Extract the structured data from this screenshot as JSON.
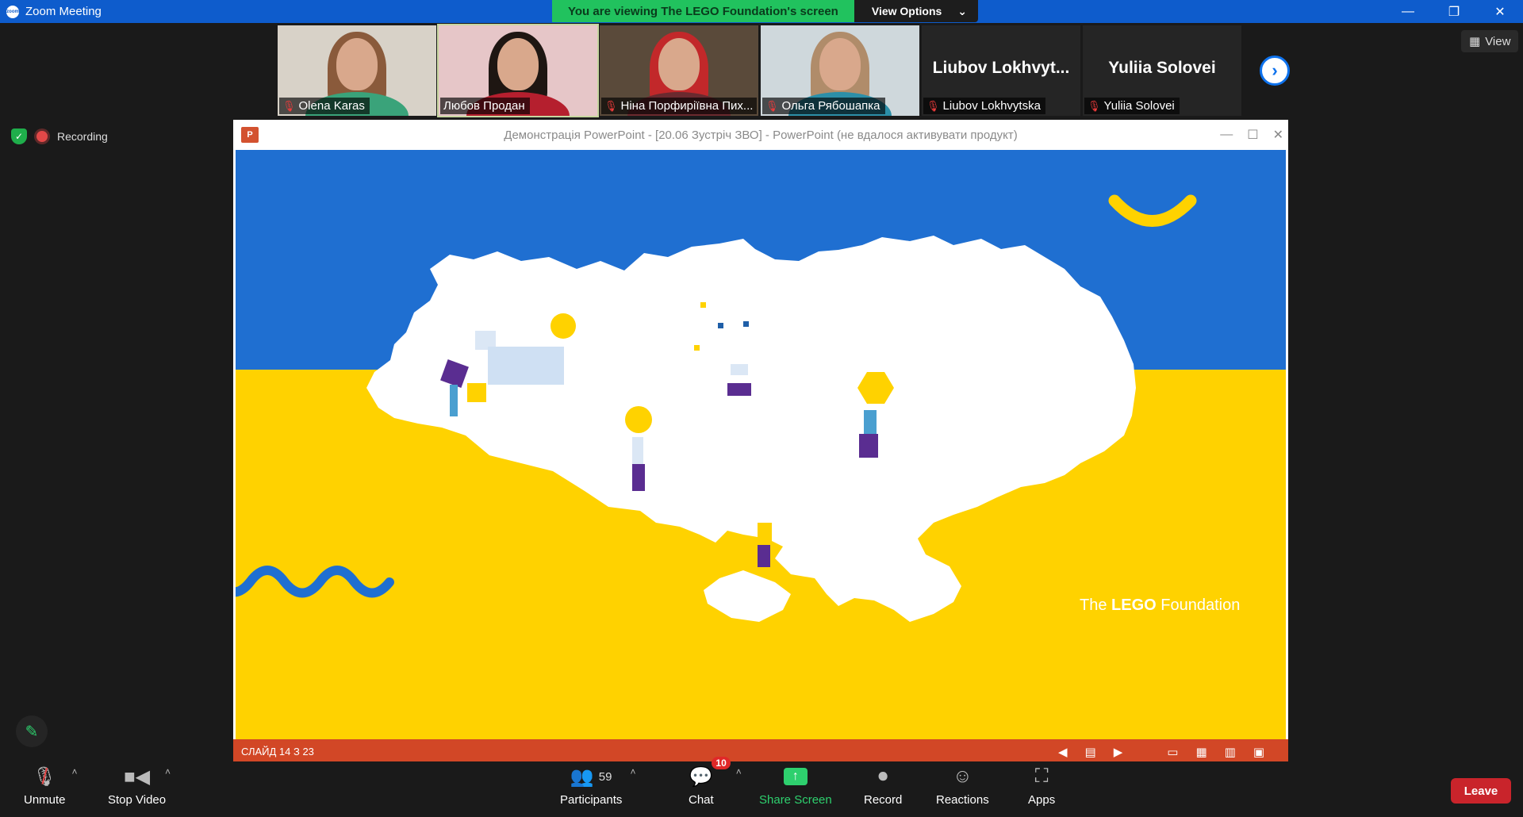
{
  "window": {
    "title": "Zoom Meeting",
    "minimize": "—",
    "restore": "❐",
    "close": "✕"
  },
  "share_banner": {
    "viewing": "You are viewing The LEGO Foundation's screen",
    "view_options": "View Options",
    "caret": "⌄"
  },
  "view_button": {
    "label": "View",
    "icon": "grid-icon"
  },
  "participants_strip": [
    {
      "name": "Olena Karas",
      "type": "video",
      "muted": true,
      "hair": "#8a5a3b",
      "shirt": "#3aa37a",
      "bg": "#d8d2c8"
    },
    {
      "name": "Любов Продан",
      "type": "video",
      "muted": false,
      "hair": "#1e1612",
      "shirt": "#b51f2e",
      "bg": "#e6c6c8"
    },
    {
      "name": "Ніна Порфиріївна Пих...",
      "type": "video",
      "muted": true,
      "hair": "#c2282a",
      "shirt": "#6b2a2f",
      "bg": "#5a4a3a"
    },
    {
      "name": "Ольга Рябошапка",
      "type": "video",
      "muted": true,
      "hair": "#b08c6a",
      "shirt": "#2c8fa8",
      "bg": "#cfd8dc"
    },
    {
      "name": "Liubov Lokhvytska",
      "display_name": "Liubov  Lokhvyt...",
      "type": "name",
      "muted": true
    },
    {
      "name": "Yuliia Solovei",
      "display_name": "Yuliia Solovei",
      "type": "name",
      "muted": true
    }
  ],
  "status": {
    "recording_label": "Recording"
  },
  "ppt": {
    "title": "Демонстрація PowerPoint - [20.06 Зустріч ЗВО] - PowerPoint (не вдалося активувати продукт)",
    "icon_label": "P",
    "slide_status": "СЛАЙД 14 З 23",
    "brand_the": "The",
    "brand_lego": "LEGO",
    "brand_foundation": "Foundation"
  },
  "toolbar": {
    "unmute": "Unmute",
    "stop_video": "Stop Video",
    "participants": "Participants",
    "participants_count": "59",
    "chat": "Chat",
    "chat_badge": "10",
    "share_screen": "Share Screen",
    "record": "Record",
    "reactions": "Reactions",
    "apps": "Apps",
    "leave": "Leave"
  },
  "colors": {
    "ukraine_blue": "#1f6fd1",
    "ukraine_yellow": "#ffd200",
    "zoom_blue": "#0e5ccc",
    "banner_green": "#21c25e",
    "ppt_red": "#d24726",
    "leave_red": "#c9242b"
  }
}
